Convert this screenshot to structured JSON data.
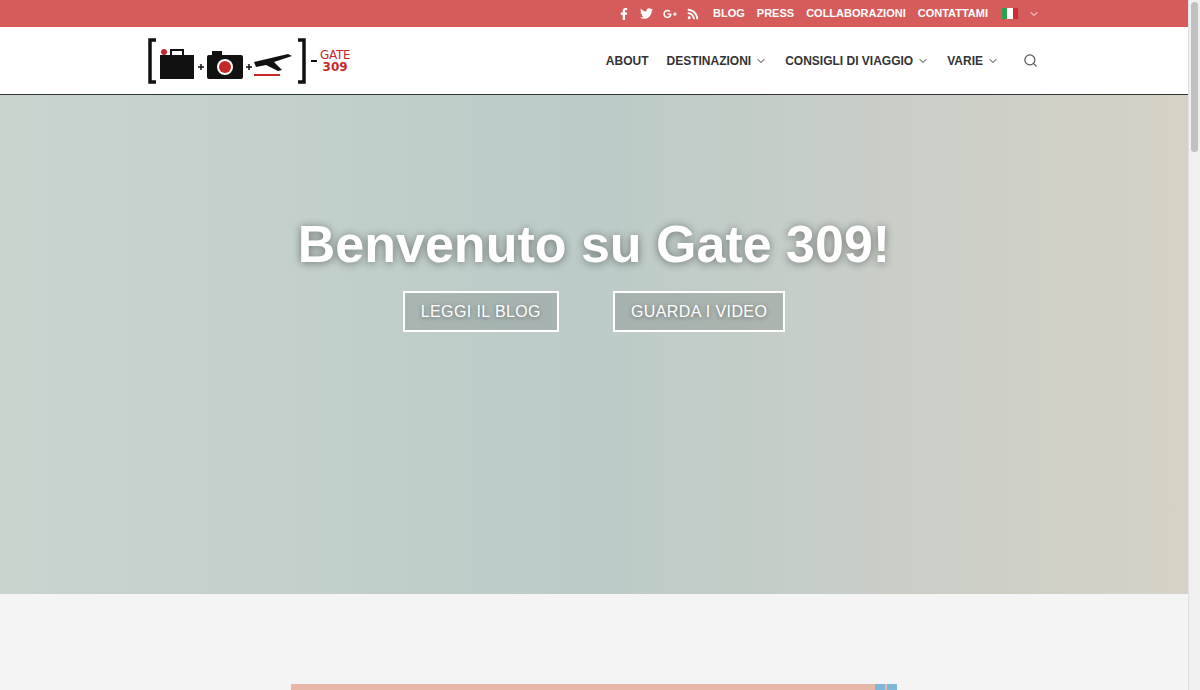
{
  "topbar": {
    "links": [
      "BLOG",
      "PRESS",
      "COLLABORAZIONI",
      "CONTATTAMI"
    ]
  },
  "logo": {
    "name": "GATE",
    "number": "309"
  },
  "nav": [
    {
      "label": "ABOUT",
      "dropdown": false
    },
    {
      "label": "DESTINAZIONI",
      "dropdown": true
    },
    {
      "label": "CONSIGLI DI VIAGGIO",
      "dropdown": true
    },
    {
      "label": "VARIE",
      "dropdown": true
    }
  ],
  "hero": {
    "title": "Benvenuto su Gate 309!",
    "buttons": [
      "LEGGI IL BLOG",
      "GUARDA I VIDEO"
    ]
  }
}
